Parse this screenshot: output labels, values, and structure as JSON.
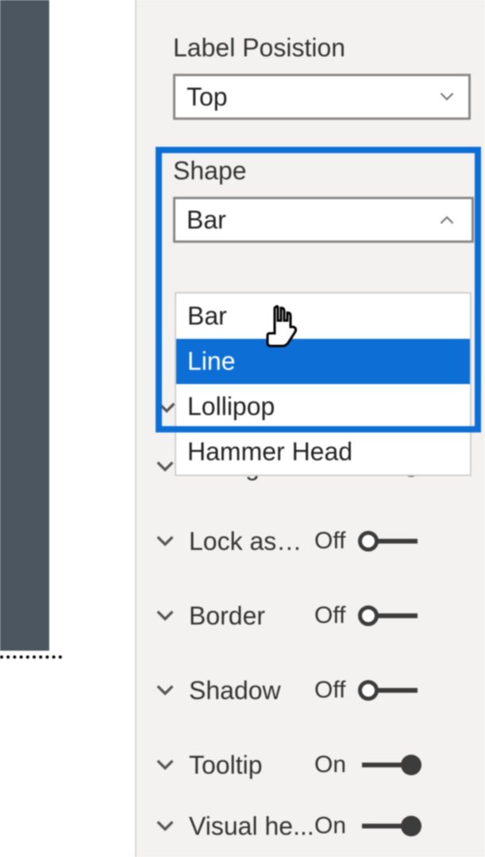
{
  "labelPosition": {
    "label": "Label Posistion",
    "value": "Top"
  },
  "shape": {
    "label": "Shape",
    "value": "Bar",
    "options": [
      "Bar",
      "Line",
      "Lollipop",
      "Hammer Head"
    ],
    "highlighted": "Line"
  },
  "properties": [
    {
      "label": "Backgrou...",
      "state": "On",
      "on": true
    },
    {
      "label": "Lock aspe...",
      "state": "Off",
      "on": false
    },
    {
      "label": "Border",
      "state": "Off",
      "on": false
    },
    {
      "label": "Shadow",
      "state": "Off",
      "on": false
    },
    {
      "label": "Tooltip",
      "state": "On",
      "on": true
    },
    {
      "label": "Visual he...",
      "state": "On",
      "on": true
    }
  ],
  "colors": {
    "highlight": "#0d6fd6",
    "selectionBg": "#0d6fd6"
  }
}
